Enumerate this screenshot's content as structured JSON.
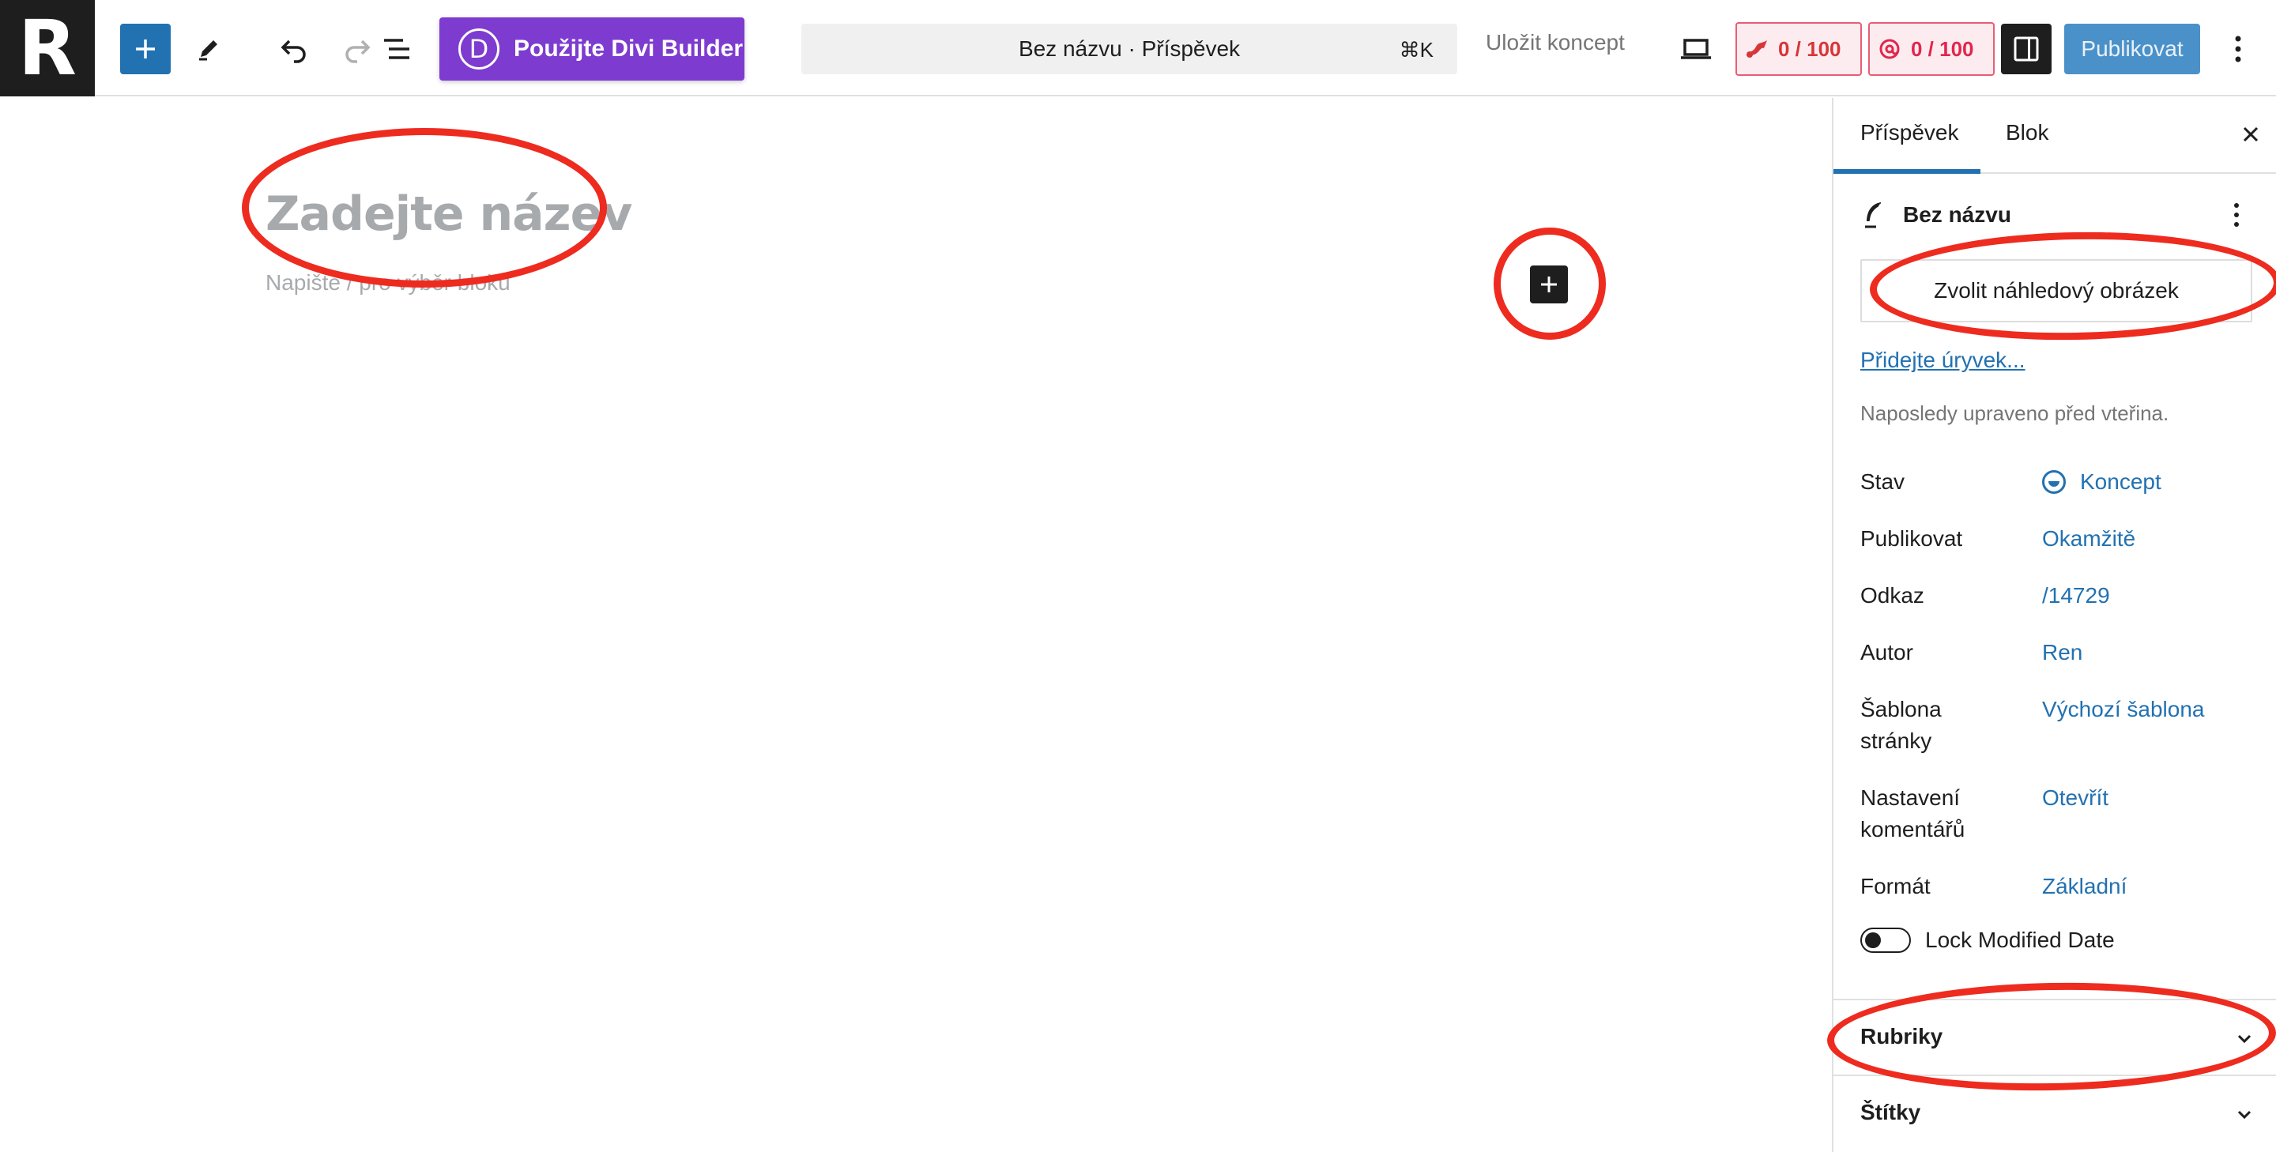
{
  "topbar": {
    "logo_letter": "R",
    "divi_icon_letter": "D",
    "divi_label": "Použijte Divi Builder",
    "document_title": "Bez názvu · Příspěvek",
    "shortcut": "⌘K",
    "save_draft_label": "Uložit koncept",
    "score_seo": "0 / 100",
    "score_readability": "0 / 100",
    "publish_label": "Publikovat"
  },
  "editor": {
    "title_placeholder": "Zadejte název",
    "block_placeholder": "Napište / pro výběr bloku"
  },
  "sidebar": {
    "tabs": [
      {
        "label": "Příspěvek",
        "active": true
      },
      {
        "label": "Blok",
        "active": false
      }
    ],
    "post_name": "Bez názvu",
    "featured_image_label": "Zvolit náhledový obrázek",
    "excerpt_link": "Přidejte úryvek...",
    "last_edited": "Naposledy upraveno před vteřina.",
    "summary": [
      {
        "key": "Stav",
        "value": "Koncept"
      },
      {
        "key": "Publikovat",
        "value": "Okamžitě"
      },
      {
        "key": "Odkaz",
        "value": "/14729"
      },
      {
        "key": "Autor",
        "value": "Ren"
      },
      {
        "key": "Šablona stránky",
        "value": "Výchozí šablona"
      },
      {
        "key": "Nastavení komentářů",
        "value": "Otevřít"
      },
      {
        "key": "Formát",
        "value": "Základní"
      }
    ],
    "lock_modified_label": "Lock Modified Date",
    "panels": [
      {
        "title": "Rubriky"
      },
      {
        "title": "Štítky"
      }
    ]
  },
  "colors": {
    "accent": "#2271b1",
    "divi": "#7e3bd0",
    "annotation": "#ee2b1f"
  }
}
